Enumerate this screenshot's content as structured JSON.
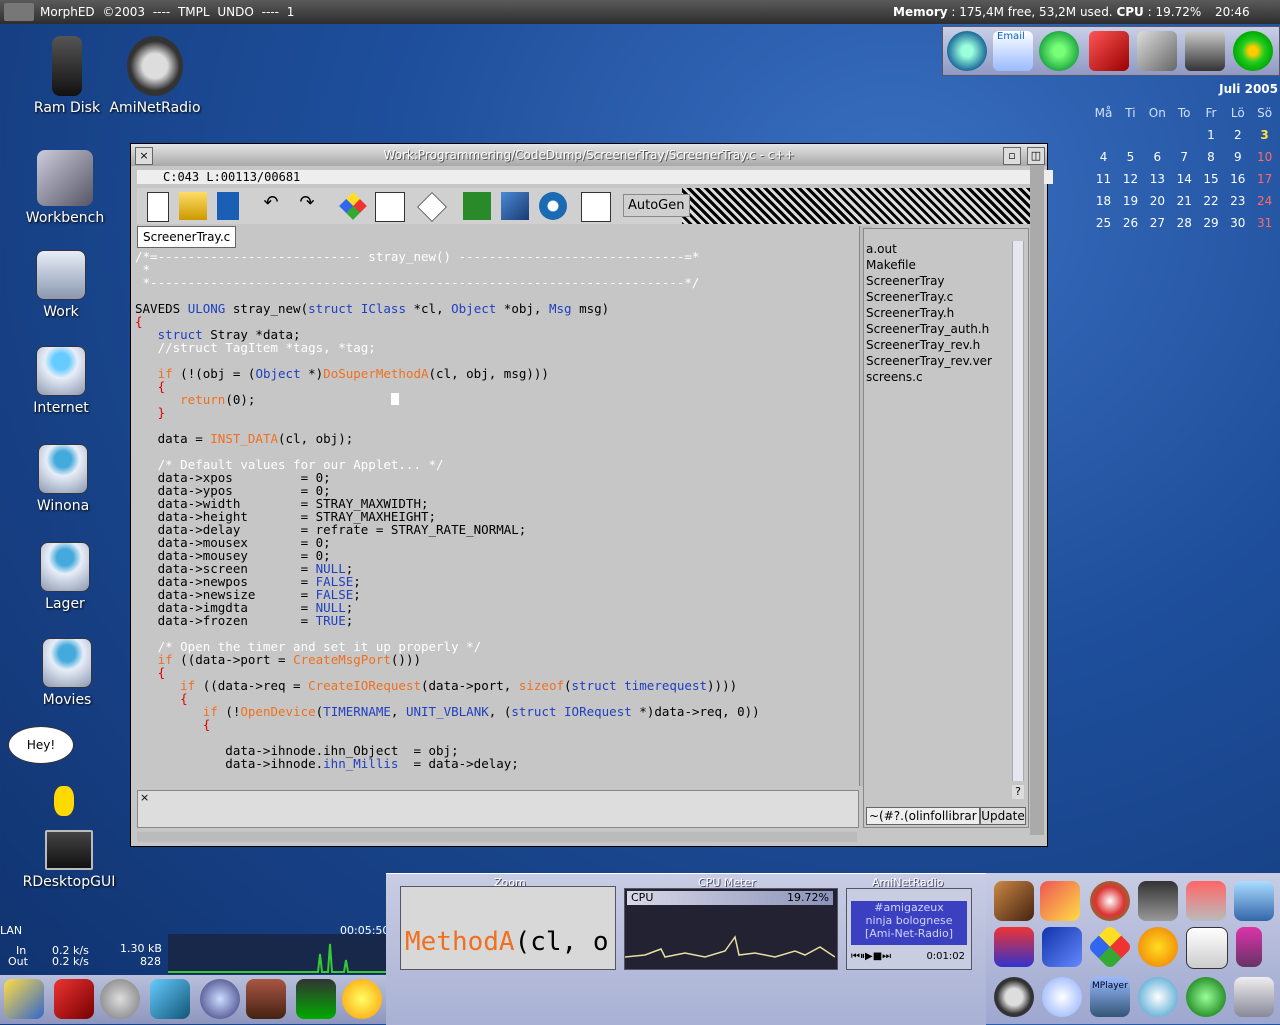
{
  "topbar": {
    "left_text": "MorphED  ©2003  ----  TMPL  UNDO  ----  1",
    "memory_label": "Memory",
    "memory_value": " : 175,4M free, 53,2M used.",
    "cpu_label": "CPU",
    "cpu_value": " : 19.72%",
    "clock": "20:46"
  },
  "desktop_icons": [
    {
      "label": "Ram Disk",
      "icon": "ram-disk-icon"
    },
    {
      "label": "AmiNetRadio",
      "icon": "headphones-icon"
    },
    {
      "label": "Workbench",
      "icon": "computer-icon"
    },
    {
      "label": "Work",
      "icon": "drive-icon"
    },
    {
      "label": "Internet",
      "icon": "globe-drive-icon"
    },
    {
      "label": "Winona",
      "icon": "butterfly-drive-icon"
    },
    {
      "label": "Lager",
      "icon": "butterfly-drive-icon"
    },
    {
      "label": "Movies",
      "icon": "butterfly-drive-icon"
    },
    {
      "label": "RDesktopGUI",
      "icon": "remote-desktop-icon"
    }
  ],
  "bubble": "Hey!",
  "dock_top": {
    "email_label": "Email"
  },
  "calendar": {
    "month": "Juli",
    "year": "2005",
    "weekdays": [
      "Må",
      "Ti",
      "On",
      "To",
      "Fr",
      "Lö",
      "Sö"
    ],
    "weeks": [
      [
        "",
        "",
        "",
        "",
        "1",
        "2",
        "3"
      ],
      [
        "4",
        "5",
        "6",
        "7",
        "8",
        "9",
        "10"
      ],
      [
        "11",
        "12",
        "13",
        "14",
        "15",
        "16",
        "17"
      ],
      [
        "18",
        "19",
        "20",
        "21",
        "22",
        "23",
        "24"
      ],
      [
        "25",
        "26",
        "27",
        "28",
        "29",
        "30",
        "31"
      ]
    ]
  },
  "editor": {
    "title": "Work:Programmering/CodeDump/ScreenerTray/ScreenerTray.c   -   c++",
    "status": "C:043 L:00113/00681",
    "autogen_label": "AutoGen",
    "file_tab": "ScreenerTray.c",
    "files": [
      "a.out",
      "Makefile",
      "ScreenerTray",
      "ScreenerTray.c",
      "ScreenerTray.h",
      "ScreenerTray_auth.h",
      "ScreenerTray_rev.h",
      "ScreenerTray_rev.ver",
      "screens.c"
    ],
    "pattern_value": "~(#?.(olinfollibrar",
    "update_label": "Update",
    "help_label": "?"
  },
  "bottom": {
    "lan_title": "LAN",
    "lan_in_label": "In",
    "lan_out_label": "Out",
    "lan_in_rate": "0.2 k/s",
    "lan_out_rate": "0.2 k/s",
    "lan_total": "1.30 kB",
    "lan_count": "828",
    "lan_time": "00:05:50",
    "zoom_title": "Zoom",
    "zoom_text_func": "MethodA",
    "zoom_text_rest": "(cl, o",
    "cpu_meter_title": "CPU Meter",
    "cpu_meter_label": "CPU",
    "cpu_meter_value": "19.72%",
    "radio_title": "AmiNetRadio",
    "radio_lines": [
      "#amigazeux",
      "ninja bolognese",
      "[Ami-Net-Radio]"
    ],
    "radio_time": "0:01:02",
    "mplayer_label": "MPlayer"
  }
}
